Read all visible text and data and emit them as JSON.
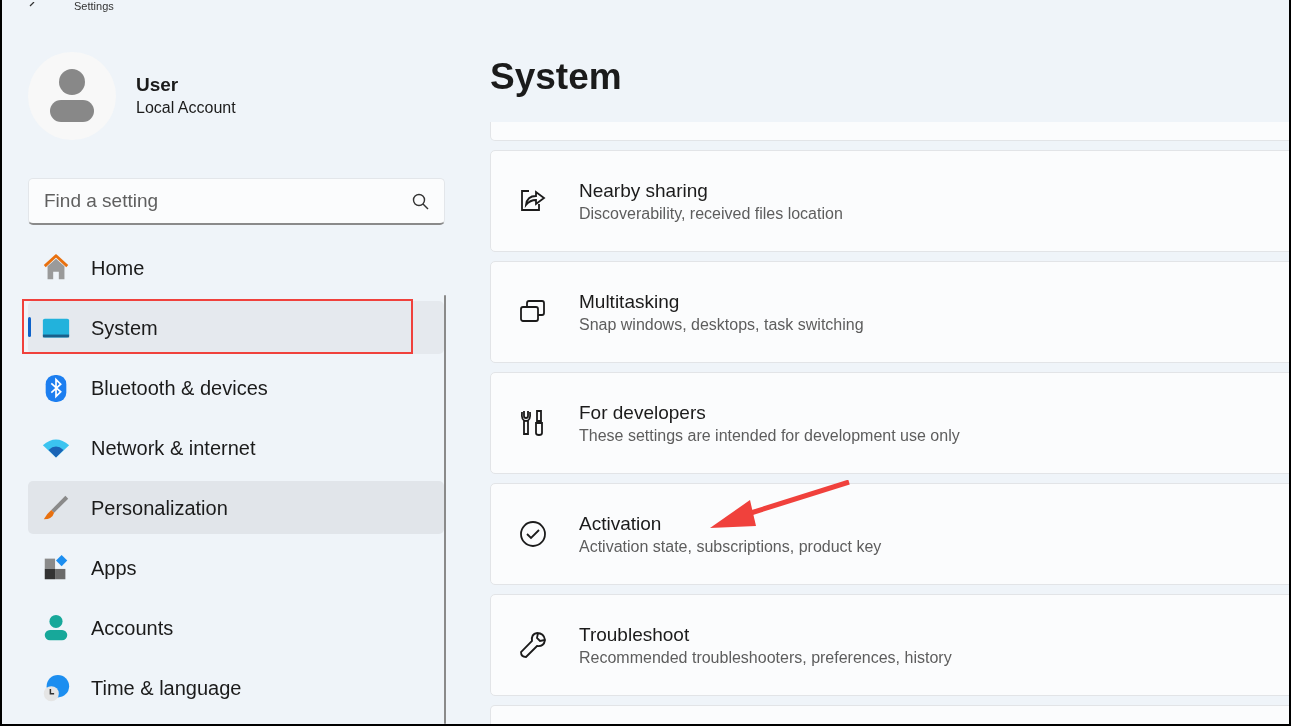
{
  "window": {
    "title": "Settings"
  },
  "account": {
    "name": "User",
    "type": "Local Account"
  },
  "search": {
    "placeholder": "Find a setting"
  },
  "sidebar": {
    "items": [
      {
        "label": "Home",
        "selected": false
      },
      {
        "label": "System",
        "selected": true,
        "highlighted": true
      },
      {
        "label": "Bluetooth & devices",
        "selected": false
      },
      {
        "label": "Network & internet",
        "selected": false
      },
      {
        "label": "Personalization",
        "selected": false,
        "hovered": true
      },
      {
        "label": "Apps",
        "selected": false
      },
      {
        "label": "Accounts",
        "selected": false
      },
      {
        "label": "Time & language",
        "selected": false
      }
    ]
  },
  "page": {
    "title": "System"
  },
  "cards": [
    {
      "title": "Nearby sharing",
      "subtitle": "Discoverability, received files location"
    },
    {
      "title": "Multitasking",
      "subtitle": "Snap windows, desktops, task switching"
    },
    {
      "title": "For developers",
      "subtitle": "These settings are intended for development use only"
    },
    {
      "title": "Activation",
      "subtitle": "Activation state, subscriptions, product key",
      "pointed": true
    },
    {
      "title": "Troubleshoot",
      "subtitle": "Recommended troubleshooters, preferences, history"
    }
  ]
}
